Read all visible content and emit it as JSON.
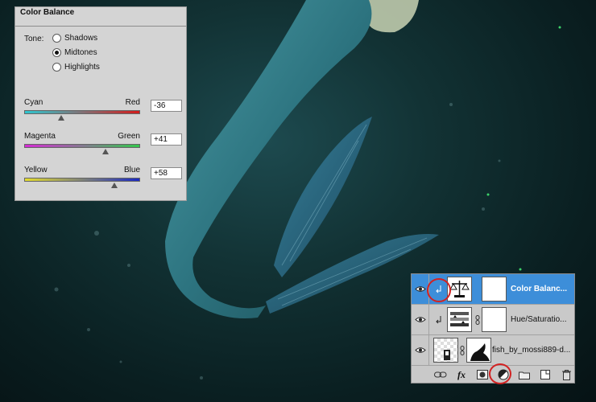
{
  "color_balance": {
    "title": "Color Balance",
    "tone_label": "Tone:",
    "tones": [
      {
        "label": "Shadows",
        "checked": false
      },
      {
        "label": "Midtones",
        "checked": true
      },
      {
        "label": "Highlights",
        "checked": false
      }
    ],
    "sliders": [
      {
        "left": "Cyan",
        "right": "Red",
        "value": "-36",
        "left_color": "#2fc6cf",
        "right_color": "#d31c1c",
        "fraction": 0.32
      },
      {
        "left": "Magenta",
        "right": "Green",
        "value": "+41",
        "left_color": "#d52ad5",
        "right_color": "#32c74b",
        "fraction": 0.7
      },
      {
        "left": "Yellow",
        "right": "Blue",
        "value": "+58",
        "left_color": "#e4dc2e",
        "right_color": "#1b2ac4",
        "fraction": 0.78
      }
    ]
  },
  "layers": {
    "rows": [
      {
        "name": "Color Balanc...",
        "selected": true,
        "clipped": true,
        "thumb_icon": "balance-scale-icon"
      },
      {
        "name": "Hue/Saturatio...",
        "selected": false,
        "clipped": true,
        "thumb_icon": "hue-saturation-icon"
      },
      {
        "name": "fish_by_mossi889-d...",
        "selected": false,
        "clipped": false,
        "thumb_icon": "image-thumbnail-icon"
      }
    ],
    "footer_icons": [
      "link-layers-icon",
      "fx-icon",
      "add-mask-icon",
      "adjustment-layer-icon",
      "new-group-icon",
      "new-layer-icon",
      "trash-icon"
    ],
    "footer_fx_label": "fx"
  },
  "colors": {
    "selected_layer": "#3d8ed9",
    "highlight_circle": "#d22222",
    "background": "#0f2a2c"
  }
}
